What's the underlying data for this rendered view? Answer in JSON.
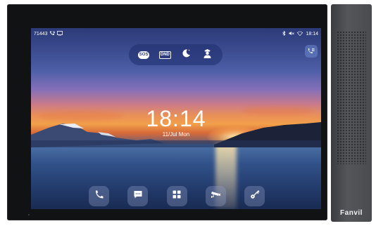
{
  "status_bar": {
    "left_text": "71443",
    "time": "18:14",
    "icons_left": [
      "missed-call-icon",
      "screen-cast-icon"
    ],
    "icons_right": [
      "bluetooth-icon",
      "mute-icon",
      "wifi-icon"
    ]
  },
  "quick_actions": [
    {
      "name": "sos",
      "label": "SOS"
    },
    {
      "name": "dnd",
      "label": "DND"
    },
    {
      "name": "night-mode",
      "icon": "moon-icon"
    },
    {
      "name": "guard",
      "icon": "guard-icon"
    }
  ],
  "clock": {
    "time": "18:14",
    "date": "11/Jul Mon"
  },
  "dock": [
    {
      "name": "phone",
      "icon": "phone-icon"
    },
    {
      "name": "messages",
      "icon": "message-icon"
    },
    {
      "name": "apps",
      "icon": "apps-grid-icon"
    },
    {
      "name": "camera",
      "icon": "cctv-camera-icon"
    },
    {
      "name": "unlock",
      "icon": "key-icon"
    }
  ],
  "brand": {
    "logo_text": "Fanvil"
  },
  "colors": {
    "bezel": "#111214",
    "panel": "#4a4b4e",
    "dock_button": "#96a0c8"
  }
}
